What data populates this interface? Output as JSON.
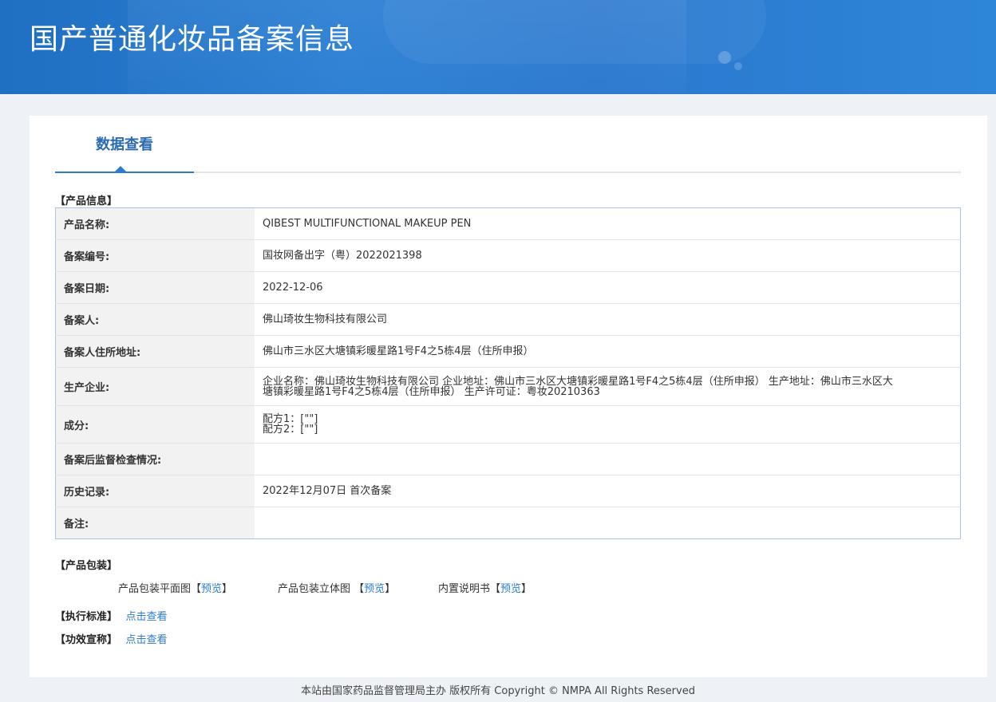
{
  "banner": {
    "title": "国产普通化妆品备案信息"
  },
  "tab": {
    "label": "数据查看"
  },
  "sections": {
    "product_info": "【产品信息】",
    "product_package": "【产品包装】",
    "exec_standard": "【执行标准】",
    "efficacy": "【功效宣称】"
  },
  "rows": [
    {
      "key": "产品名称:",
      "value": "QIBEST MULTIFUNCTIONAL MAKEUP PEN"
    },
    {
      "key": "备案编号:",
      "value": "国妆网备出字（粤）2022021398"
    },
    {
      "key": "备案日期:",
      "value": "2022-12-06"
    },
    {
      "key": "备案人:",
      "value": "佛山琦妆生物科技有限公司"
    },
    {
      "key": "备案人住所地址:",
      "value": "佛山市三水区大塘镇彩暖星路1号F4之5栋4层（住所申报）"
    },
    {
      "key": "生产企业:",
      "value_line1": "企业名称：佛山琦妆生物科技有限公司 企业地址：佛山市三水区大塘镇彩暖星路1号F4之5栋4层（住所申报） 生产地址：佛山市三水区大",
      "value_line2": "塘镇彩暖星路1号F4之5栋4层（住所申报） 生产许可证：粤妆20210363"
    },
    {
      "key": "成分:",
      "value_line1": "配方1：[\"\"]",
      "value_line2": "配方2：[\"\"]"
    },
    {
      "key": "备案后监督检查情况:",
      "value": ""
    },
    {
      "key": "历史记录:",
      "value": "2022年12月07日 首次备案"
    },
    {
      "key": "备注:",
      "value": ""
    }
  ],
  "package": {
    "flat_label": "产品包装平面图",
    "solid_label": "产品包装立体图",
    "manual_label": "内置说明书",
    "bracket_open": "【",
    "bracket_close": "】",
    "preview": "预览"
  },
  "links": {
    "view": "点击查看"
  },
  "footer": {
    "text": "本站由国家药品监督管理局主办 版权所有 Copyright © NMPA All Rights Reserved"
  },
  "colors": {
    "banner": "#2a78cf",
    "link": "#2b7ccf",
    "tab_text": "#2a6ab3"
  }
}
